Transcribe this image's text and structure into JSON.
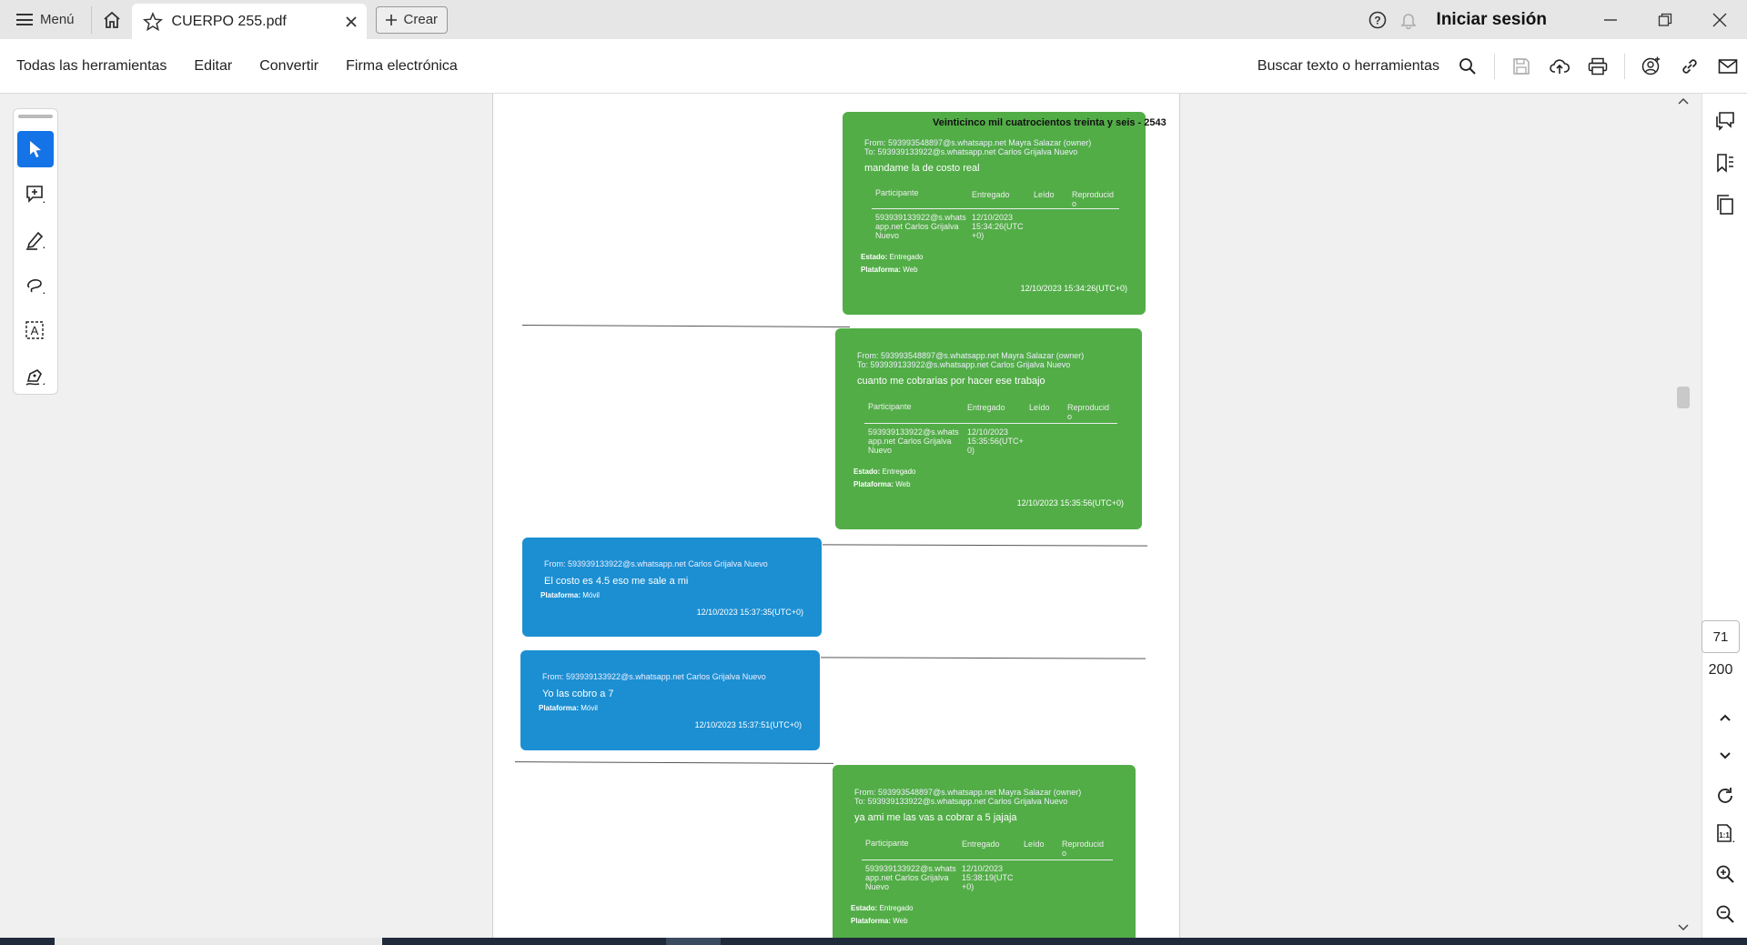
{
  "tabbar": {
    "menu_label": "Menú",
    "tab_title": "CUERPO 255.pdf",
    "create_label": "Crear",
    "login_label": "Iniciar sesión"
  },
  "toolbar": {
    "items": [
      "Todas las herramientas",
      "Editar",
      "Convertir",
      "Firma electrónica"
    ],
    "search_label": "Buscar texto o herramientas"
  },
  "document": {
    "header_title": "Veinticinco mil cuatrocientos treinta y seis - 2543",
    "table_headers": [
      "Participante",
      "Entregado",
      "Leído",
      "Reproducid o"
    ],
    "messages": [
      {
        "type": "outgoing",
        "from": "From: 593993548897@s.whatsapp.net Mayra Salazar (owner)",
        "to": "To: 593939133922@s.whatsapp.net Carlos Grijalva Nuevo",
        "text": "mandame la de costo real",
        "participant": "593939133922@s.whats app.net Carlos Grijalva Nuevo",
        "delivered": "12/10/2023 15:34:26(UTC +0)",
        "estado": "Entregado",
        "plataforma": "Web",
        "timestamp": "12/10/2023 15:34:26(UTC+0)"
      },
      {
        "type": "outgoing",
        "from": "From: 593993548897@s.whatsapp.net Mayra Salazar (owner)",
        "to": "To: 593939133922@s.whatsapp.net Carlos Grijalva Nuevo",
        "text": "cuanto me cobrarias por hacer ese trabajo",
        "participant": "593939133922@s.whats app.net Carlos Grijalva Nuevo",
        "delivered": "12/10/2023 15:35:56(UTC+ 0)",
        "estado": "Entregado",
        "plataforma": "Web",
        "timestamp": "12/10/2023 15:35:56(UTC+0)"
      },
      {
        "type": "incoming",
        "from": "From: 593939133922@s.whatsapp.net Carlos Grijalva Nuevo",
        "text": "El costo es 4.5 eso me sale a mi",
        "plataforma": "Móvil",
        "timestamp": "12/10/2023 15:37:35(UTC+0)"
      },
      {
        "type": "incoming",
        "from": "From: 593939133922@s.whatsapp.net Carlos Grijalva Nuevo",
        "text": "Yo las cobro a 7",
        "plataforma": "Móvil",
        "timestamp": "12/10/2023 15:37:51(UTC+0)"
      },
      {
        "type": "outgoing",
        "from": "From: 593993548897@s.whatsapp.net Mayra Salazar (owner)",
        "to": "To: 593939133922@s.whatsapp.net Carlos Grijalva Nuevo",
        "text": "ya ami me las vas a cobrar a 5 jajaja",
        "participant": "593939133922@s.whats app.net Carlos Grijalva Nuevo",
        "delivered": "12/10/2023 15:38:19(UTC +0)",
        "estado": "Entregado",
        "plataforma": "Web"
      }
    ],
    "labels": {
      "estado": "Estado:",
      "plataforma": "Plataforma:"
    }
  },
  "pagination": {
    "current_page": "71",
    "total_pages": "200"
  },
  "colors": {
    "accent": "#1473e6",
    "green_bubble": "#52ad47",
    "blue_bubble": "#1c8fd2"
  }
}
